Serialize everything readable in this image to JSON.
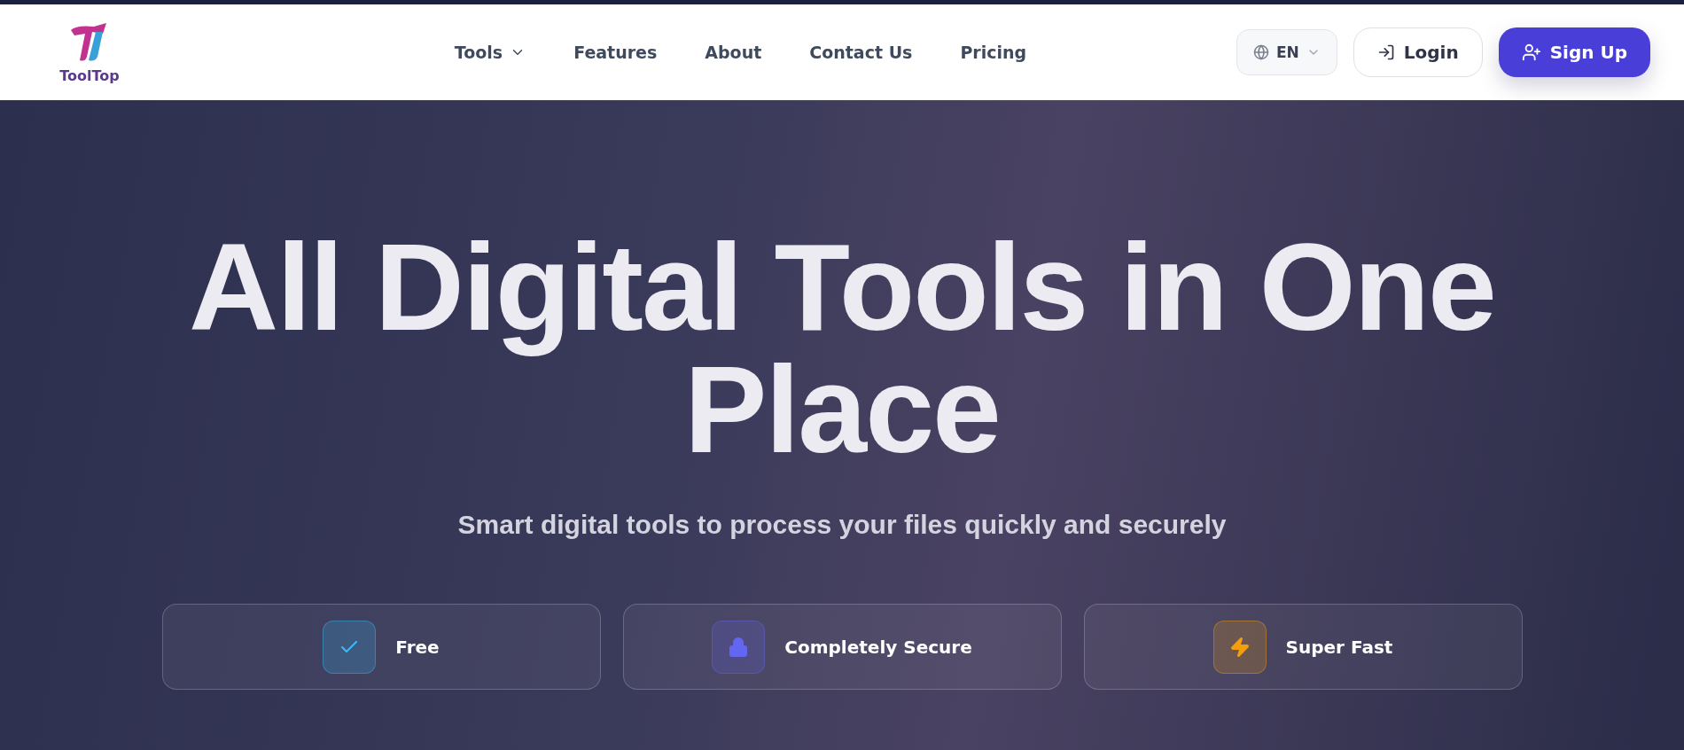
{
  "header": {
    "logo_text": "ToolTop",
    "nav": [
      {
        "label": "Tools",
        "dropdown": true
      },
      {
        "label": "Features",
        "dropdown": false
      },
      {
        "label": "About",
        "dropdown": false
      },
      {
        "label": "Contact Us",
        "dropdown": false
      },
      {
        "label": "Pricing",
        "dropdown": false
      }
    ],
    "language": "EN",
    "login": "Login",
    "signup": "Sign Up"
  },
  "hero": {
    "title": "All Digital Tools in One Place",
    "subtitle": "Smart digital tools to process your files quickly and securely",
    "features": [
      {
        "kind": "check",
        "label": "Free",
        "color": "#38bdf8"
      },
      {
        "kind": "lock",
        "label": "Completely Secure",
        "color": "#6366f1"
      },
      {
        "kind": "bolt",
        "label": "Super Fast",
        "color": "#f59e0b"
      }
    ]
  }
}
